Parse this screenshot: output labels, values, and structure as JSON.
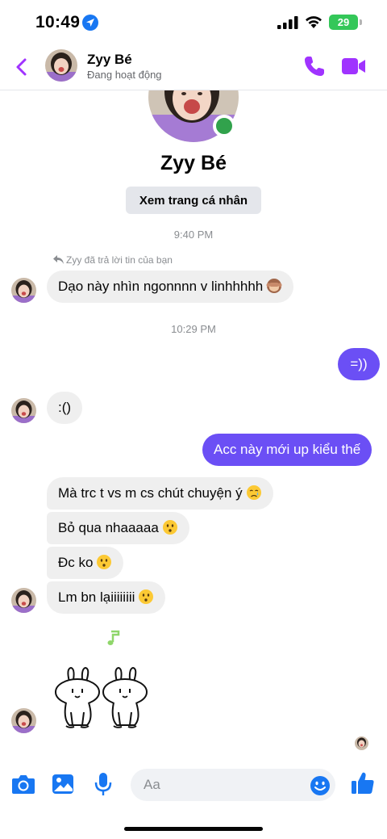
{
  "status_bar": {
    "time": "10:49",
    "battery": "29"
  },
  "header": {
    "name": "Zyy Bé",
    "status": "Đang hoạt động"
  },
  "profile": {
    "name": "Zyy Bé",
    "view_profile_label": "Xem trang cá nhân"
  },
  "timestamps": [
    "9:40 PM",
    "10:29 PM"
  ],
  "reply_note": "Zyy đã trả lời tin của bạn",
  "messages": [
    {
      "from": "them",
      "text": "Dạo này nhìn ngonnnn v linhhhhh",
      "emoji": "see-no-evil-monkey"
    },
    {
      "from": "me",
      "text": "=))"
    },
    {
      "from": "them",
      "text": ":()"
    },
    {
      "from": "me",
      "text": "Acc này mới up kiểu thế"
    },
    {
      "from": "them",
      "text": "Mà trc t vs m cs chút chuyện ý",
      "emoji": "crying-face"
    },
    {
      "from": "them",
      "text": "Bỏ qua nhaaaaa",
      "emoji": "kissing-face"
    },
    {
      "from": "them",
      "text": "Đc ko",
      "emoji": "kissing-face"
    },
    {
      "from": "them",
      "text": "Lm bn lạiiiiiiii",
      "emoji": "kissing-face"
    }
  ],
  "composer": {
    "placeholder": "Aa"
  },
  "colors": {
    "accent": "#a033ff",
    "outgoing_bubble": "#6b4ff5",
    "incoming_bubble": "#efefef",
    "online": "#31a24c",
    "icon_blue": "#1877f2"
  }
}
